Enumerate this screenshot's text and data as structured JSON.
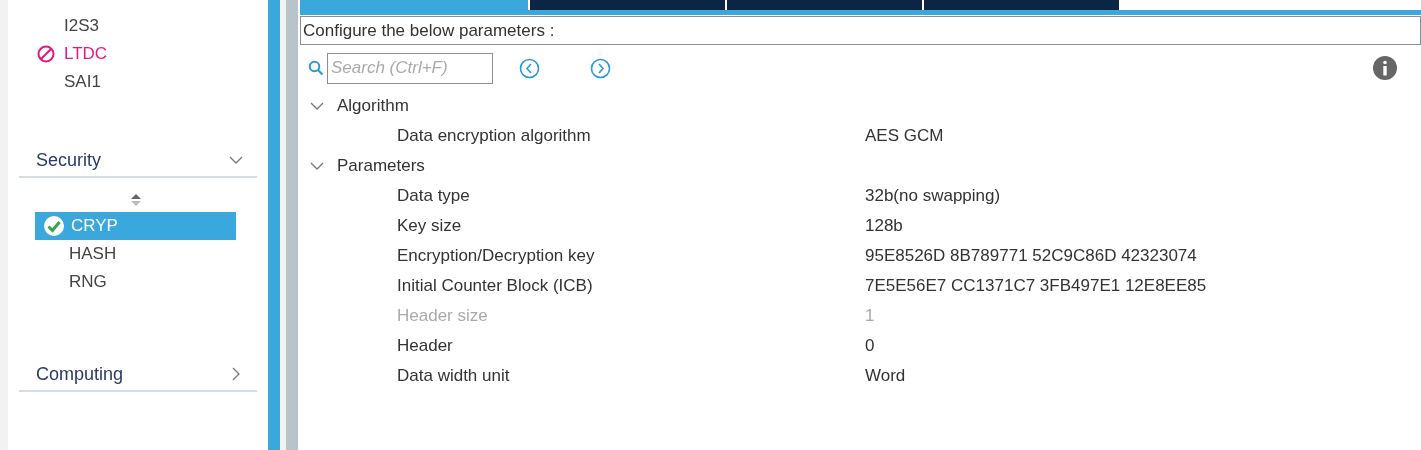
{
  "sidebar": {
    "items_top": [
      {
        "label": "I2S3",
        "kind": "plain"
      },
      {
        "label": "LTDC",
        "kind": "blocked"
      },
      {
        "label": "SAI1",
        "kind": "plain"
      }
    ],
    "categories": [
      {
        "label": "Security",
        "expanded": true,
        "items": [
          {
            "label": "CRYP",
            "kind": "ok",
            "selected": true
          },
          {
            "label": "HASH",
            "kind": "plain",
            "selected": false
          },
          {
            "label": "RNG",
            "kind": "plain",
            "selected": false
          }
        ]
      },
      {
        "label": "Computing",
        "expanded": false
      }
    ]
  },
  "tabs": [
    {
      "selected": true
    },
    {
      "selected": false
    },
    {
      "selected": false
    },
    {
      "selected": false
    }
  ],
  "panel": {
    "header": "Configure the below parameters :",
    "search": {
      "placeholder": "Search (Ctrl+F)"
    },
    "groups": [
      {
        "label": "Algorithm",
        "expanded": true,
        "params": [
          {
            "name": "Data encryption algorithm",
            "value": "AES GCM",
            "disabled": false
          }
        ]
      },
      {
        "label": "Parameters",
        "expanded": true,
        "params": [
          {
            "name": "Data type",
            "value": "32b(no swapping)",
            "disabled": false
          },
          {
            "name": "Key size",
            "value": "128b",
            "disabled": false
          },
          {
            "name": "Encryption/Decryption key",
            "value": "95E8526D 8B789771 52C9C86D 42323074",
            "disabled": false
          },
          {
            "name": "Initial Counter Block (ICB)",
            "value": "7E5E56E7 CC1371C7 3FB497E1 12E8EE85",
            "disabled": false
          },
          {
            "name": "Header size",
            "value": "1",
            "disabled": true
          },
          {
            "name": "Header",
            "value": "0",
            "disabled": false
          },
          {
            "name": "Data width unit",
            "value": "Word",
            "disabled": false
          }
        ]
      }
    ]
  }
}
